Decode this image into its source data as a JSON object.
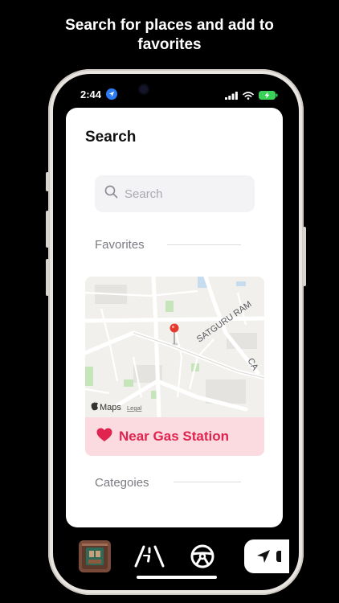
{
  "headline": "Search for places and add to favorites",
  "status_bar": {
    "time": "2:44"
  },
  "sheet": {
    "title": "Search",
    "search": {
      "placeholder": "Search",
      "value": ""
    },
    "favorites_label": "Favorites",
    "favorite": {
      "name": "Near Gas Station",
      "map_labels": {
        "road_1": "SATGURU RAM",
        "road_2": "CA"
      },
      "attribution": {
        "brand": "Maps",
        "legal": "Legal"
      }
    },
    "categories_label": "Categoies"
  },
  "colors": {
    "accent_pink": "#e0234f",
    "pink_bg": "#fcdbe0",
    "location_blue": "#2d7cf6",
    "battery_green": "#3ad158"
  },
  "tab_bar": {
    "items": [
      {
        "icon": "photo-thumbnail-icon"
      },
      {
        "icon": "road-icon"
      },
      {
        "icon": "steering-wheel-icon"
      },
      {
        "icon": "navigation-arrow-icon"
      }
    ]
  }
}
